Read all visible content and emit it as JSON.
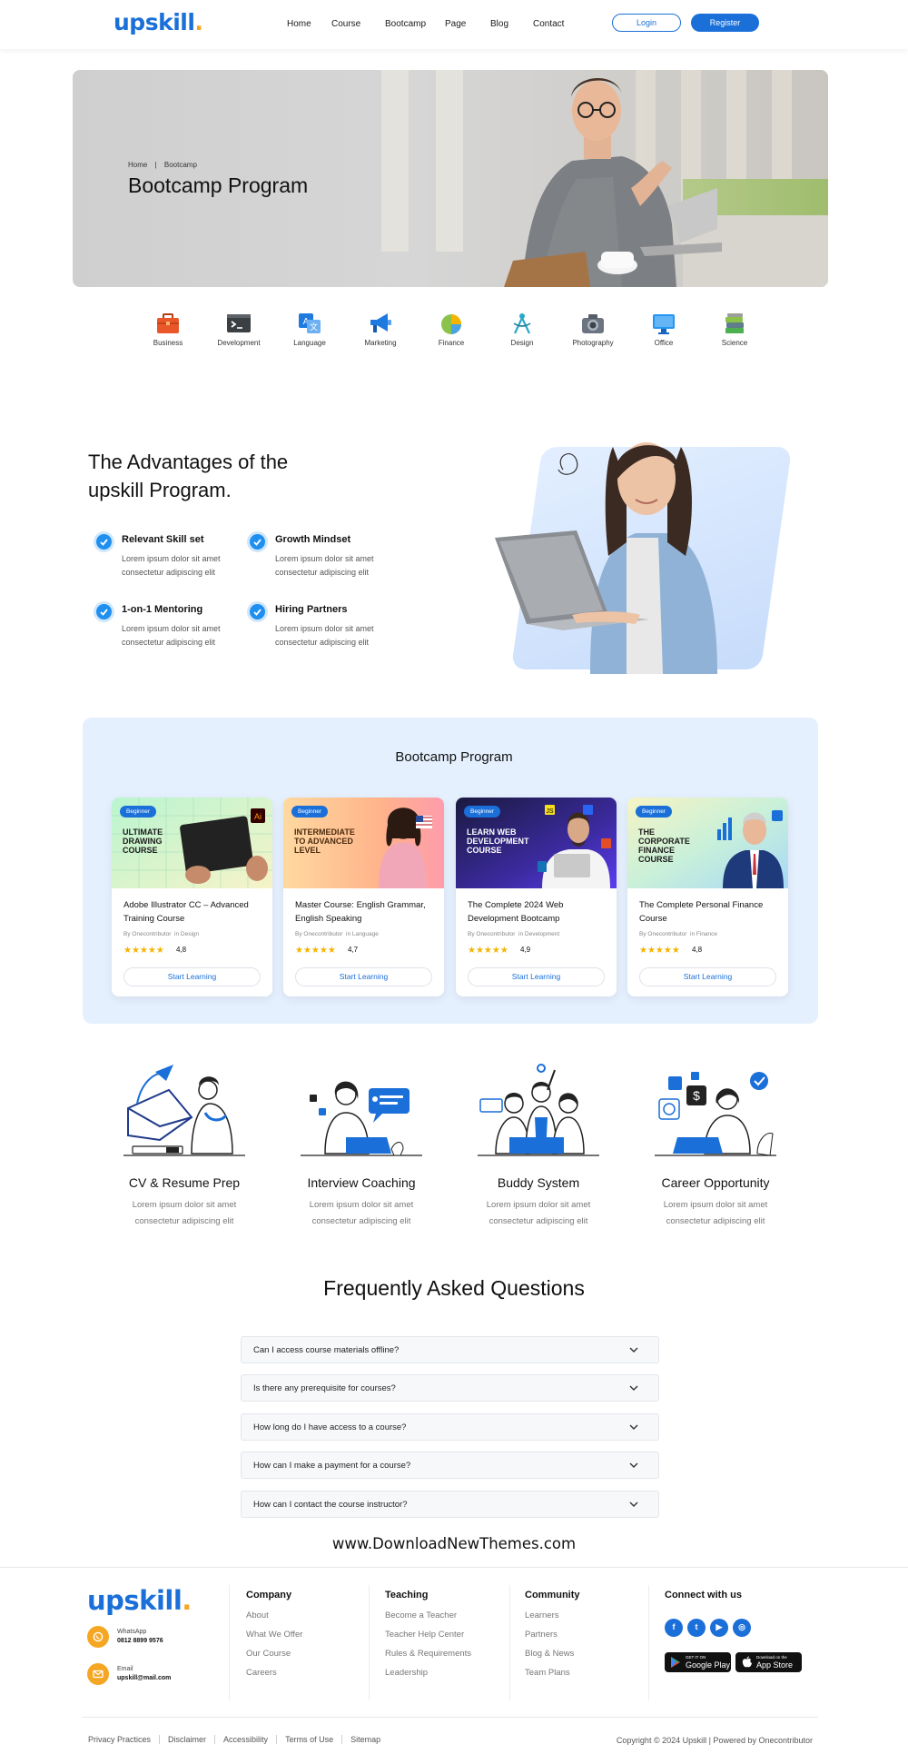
{
  "header": {
    "logo": "upskill",
    "logo_dot": ".",
    "nav": [
      "Home",
      "Course",
      "Bootcamp",
      "Page",
      "Blog",
      "Contact"
    ],
    "login": "Login",
    "register": "Register"
  },
  "hero": {
    "breadcrumb_home": "Home",
    "breadcrumb_sep": "|",
    "breadcrumb_current": "Bootcamp",
    "title": "Bootcamp Program"
  },
  "categories": [
    {
      "label": "Business",
      "icon": "briefcase-icon",
      "color": "#e8562a"
    },
    {
      "label": "Development",
      "icon": "terminal-icon",
      "color": "#3a3f44"
    },
    {
      "label": "Language",
      "icon": "translate-icon",
      "color": "#1f7ae0"
    },
    {
      "label": "Marketing",
      "icon": "megaphone-icon",
      "color": "#1f7ae0"
    },
    {
      "label": "Finance",
      "icon": "pie-chart-icon",
      "color": "#8bc34a"
    },
    {
      "label": "Design",
      "icon": "compass-icon",
      "color": "#2aa8c9"
    },
    {
      "label": "Photography",
      "icon": "camera-icon",
      "color": "#6b7480"
    },
    {
      "label": "Office",
      "icon": "monitor-icon",
      "color": "#2196f3"
    },
    {
      "label": "Science",
      "icon": "books-icon",
      "color": "#4caf50"
    }
  ],
  "advantages": {
    "title_line1": "The Advantages of the",
    "title_line2": "upskill Program.",
    "features": [
      {
        "title": "Relevant Skill set",
        "line1": "Lorem ipsum dolor sit amet",
        "line2": "consectetur adipiscing elit"
      },
      {
        "title": "Growth Mindset",
        "line1": "Lorem ipsum dolor sit amet",
        "line2": "consectetur adipiscing elit"
      },
      {
        "title": "1-on-1 Mentoring",
        "line1": "Lorem ipsum dolor sit amet",
        "line2": "consectetur adipiscing elit"
      },
      {
        "title": "Hiring Partners",
        "line1": "Lorem ipsum dolor sit amet",
        "line2": "consectetur adipiscing elit"
      }
    ]
  },
  "bootcamp": {
    "title": "Bootcamp Program",
    "cards": [
      {
        "badge": "Beginner",
        "image_text": [
          "ULTIMATE",
          "DRAWING",
          "COURSE"
        ],
        "title_line1": "Adobe Illustrator CC – Advanced",
        "title_line2": "Training Course",
        "meta_by": "By",
        "meta_author": "Onecontributor",
        "meta_in": "in",
        "meta_cat": "Design",
        "stars": "★★★★★",
        "rating": "4,8",
        "cta": "Start Learning"
      },
      {
        "badge": "Beginner",
        "image_text": [
          "INTERMEDIATE",
          "TO ADVANCED",
          "LEVEL"
        ],
        "title_line1": "Master Course: English Grammar,",
        "title_line2": "English Speaking",
        "meta_by": "By",
        "meta_author": "Onecontributor",
        "meta_in": "in",
        "meta_cat": "Language",
        "stars": "★★★★★",
        "rating": "4,7",
        "cta": "Start Learning"
      },
      {
        "badge": "Beginner",
        "image_text": [
          "LEARN WEB",
          "DEVELOPMENT",
          "COURSE"
        ],
        "title_line1": "The Complete 2024 Web",
        "title_line2": "Development Bootcamp",
        "meta_by": "By",
        "meta_author": "Onecontributor",
        "meta_in": "in",
        "meta_cat": "Development",
        "stars": "★★★★★",
        "rating": "4,9",
        "cta": "Start Learning"
      },
      {
        "badge": "Beginner",
        "image_text": [
          "THE",
          "CORPORATE",
          "FINANCE",
          "COURSE"
        ],
        "title_line1": "The Complete Personal Finance",
        "title_line2": "Course",
        "meta_by": "By",
        "meta_author": "Onecontributor",
        "meta_in": "in",
        "meta_cat": "Finance",
        "stars": "★★★★★",
        "rating": "4,8",
        "cta": "Start Learning"
      }
    ]
  },
  "services": [
    {
      "title": "CV & Resume Prep",
      "line1": "Lorem ipsum dolor sit amet",
      "line2": "consectetur adipiscing elit"
    },
    {
      "title": "Interview Coaching",
      "line1": "Lorem ipsum dolor sit amet",
      "line2": "consectetur adipiscing elit"
    },
    {
      "title": "Buddy System",
      "line1": "Lorem ipsum dolor sit amet",
      "line2": "consectetur adipiscing elit"
    },
    {
      "title": "Career Opportunity",
      "line1": "Lorem ipsum dolor sit amet",
      "line2": "consectetur adipiscing elit"
    }
  ],
  "faq": {
    "title": "Frequently Asked Questions",
    "items": [
      "Can I access course materials offline?",
      "Is there any prerequisite for courses?",
      "How long do I have access to a course?",
      "How can I make a payment for a course?",
      "How can I contact the course instructor?"
    ]
  },
  "watermark": "www.DownloadNewThemes.com",
  "footer": {
    "logo": "upskill",
    "logo_dot": ".",
    "whatsapp_label": "WhatsApp",
    "whatsapp_value": "0812 8899 9576",
    "email_label": "Email",
    "email_value": "upskill@mail.com",
    "columns": [
      {
        "heading": "Company",
        "links": [
          "About",
          "What We Offer",
          "Our Course",
          "Careers"
        ]
      },
      {
        "heading": "Teaching",
        "links": [
          "Become a Teacher",
          "Teacher Help Center",
          "Rules & Requirements",
          "Leadership"
        ]
      },
      {
        "heading": "Community",
        "links": [
          "Learners",
          "Partners",
          "Blog & News",
          "Team Plans"
        ]
      }
    ],
    "connect_heading": "Connect with us",
    "socials": [
      "f",
      "t",
      "▶",
      "◎"
    ],
    "google_play_small": "GET IT ON",
    "google_play": "Google Play",
    "app_store_small": "Download on the",
    "app_store": "App Store",
    "bottom_links": [
      "Privacy Practices",
      "Disclaimer",
      "Accessibility",
      "Terms of Use",
      "Sitemap"
    ],
    "copyright": "Copyright © 2024 Upskill | Powered by Onecontributor"
  },
  "colors": {
    "primary": "#1a6fd8",
    "accent": "#f5a623",
    "section_bg": "#e5f0fe"
  }
}
